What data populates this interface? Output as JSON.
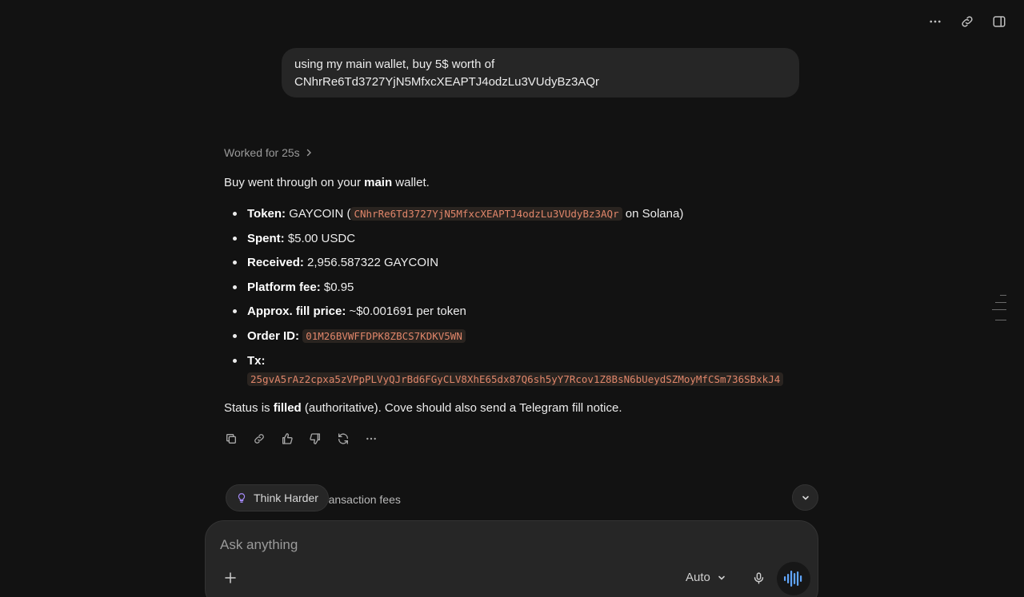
{
  "user_message": {
    "line1": "using my main wallet, buy 5$ worth of",
    "line2": "CNhrRe6Td3727YjN5MfxcXEAPTJ4odzLu3VUdyBz3AQr"
  },
  "assistant": {
    "worked_label": "Worked for 25s",
    "intro": {
      "before": "Buy went through on your ",
      "bold": "main",
      "after": " wallet."
    },
    "details": {
      "token": {
        "label": "Token:",
        "pre": " GAYCOIN (",
        "code": "CNhrRe6Td3727YjN5MfxcXEAPTJ4odzLu3VUdyBz3AQr",
        "post": " on Solana)"
      },
      "spent": {
        "label": "Spent:",
        "value": " $5.00 USDC"
      },
      "received": {
        "label": "Received:",
        "value": " 2,956.587322 GAYCOIN"
      },
      "fee": {
        "label": "Platform fee:",
        "value": " $0.95"
      },
      "price": {
        "label": "Approx. fill price:",
        "value": " ~$0.001691 per token"
      },
      "order": {
        "label": "Order ID:",
        "code": "01M26BVWFFDPK8ZBCS7KDKV5WN"
      },
      "tx": {
        "label": "Tx:",
        "code": "25gvA5rAz2cpxa5zVPpPLVyQJrBd6FGyCLV8XhE65dx87Q6sh5yY7Rcov1Z8BsN6bUeydSZMoyMfCSm736SBxkJ4"
      }
    },
    "status": {
      "before": "Status is ",
      "bold": "filled",
      "after": " (authoritative). Cove should also send a Telegram fill notice."
    }
  },
  "actions": [
    "copy-icon",
    "link-icon",
    "thumbs-up-icon",
    "thumbs-down-icon",
    "regenerate-icon",
    "more-icon"
  ],
  "suggestions": {
    "think_harder": "Think Harder",
    "partial_suggestion": "ransaction fees"
  },
  "composer": {
    "placeholder": "Ask anything",
    "model": "Auto"
  },
  "colors": {
    "background": "#121212",
    "bubble": "#262626",
    "code_text": "#e0866a",
    "code_bg": "#2a2420",
    "think_icon": "#a78bfa",
    "voice_wave": "#60a5fa"
  }
}
